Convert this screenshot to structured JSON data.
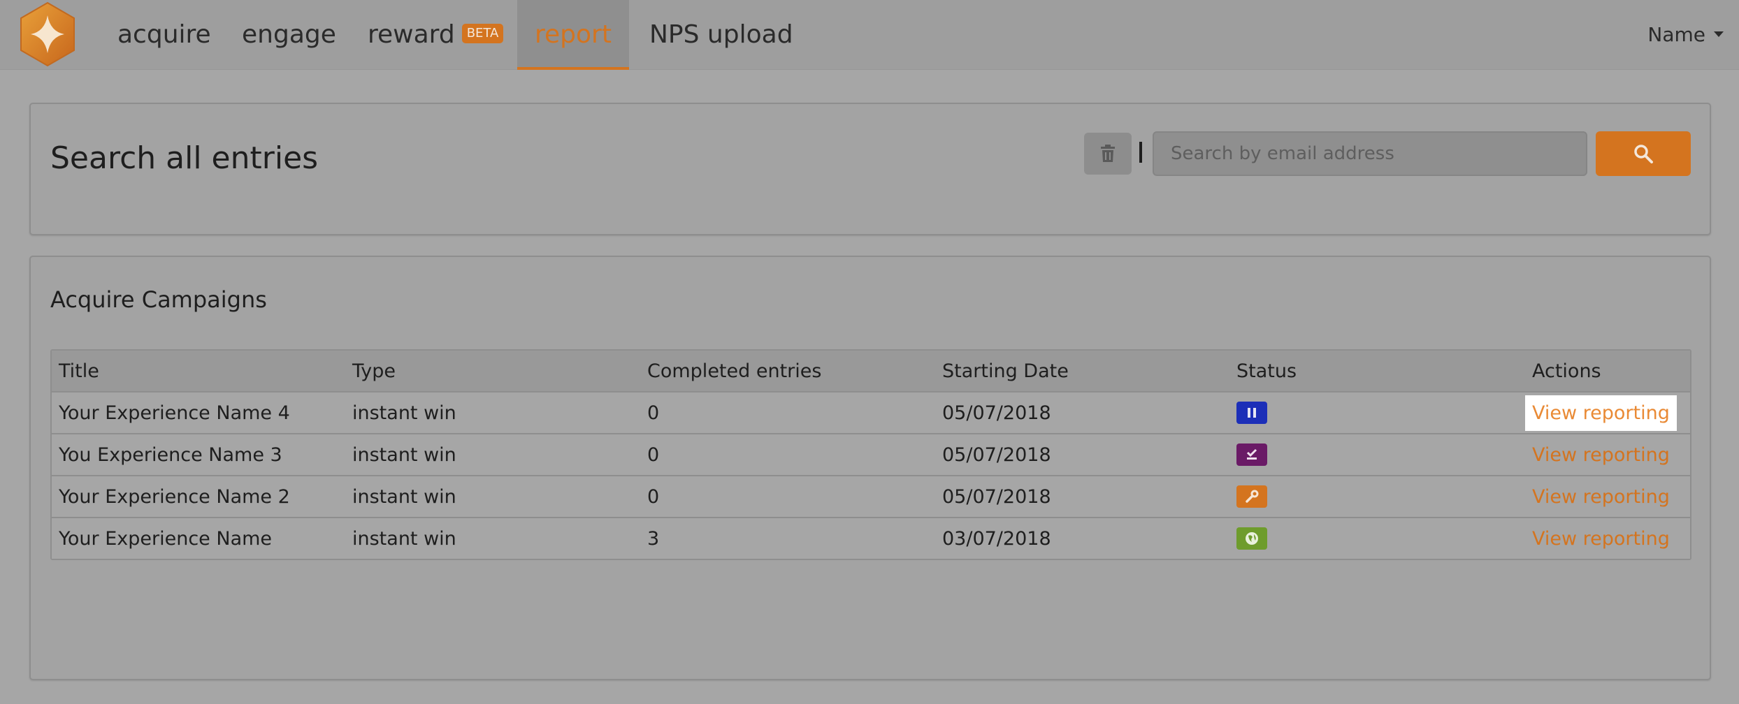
{
  "colors": {
    "accent": "#d4741f",
    "status_paused": "#1c2fb8",
    "status_scheduled": "#6a1a66",
    "status_draft": "#d4741f",
    "status_live": "#6e9c2c"
  },
  "nav": {
    "items": [
      {
        "label": "acquire"
      },
      {
        "label": "engage"
      },
      {
        "label": "reward",
        "badge": "BETA"
      },
      {
        "label": "report",
        "active": true
      },
      {
        "label": "NPS upload"
      }
    ],
    "user": "Name"
  },
  "search": {
    "title": "Search all entries",
    "placeholder": "Search by email address",
    "clear_icon": "trash-icon",
    "search_icon": "search-icon"
  },
  "campaigns": {
    "title": "Acquire Campaigns",
    "columns": [
      "Title",
      "Type",
      "Completed entries",
      "Starting Date",
      "Status",
      "Actions"
    ],
    "rows": [
      {
        "title": "Your Experience Name 4",
        "type": "instant win",
        "completed": "0",
        "date": "05/07/2018",
        "status_icon": "pause-icon",
        "action": "View reporting"
      },
      {
        "title": "You Experience Name 3",
        "type": "instant win",
        "completed": "0",
        "date": "05/07/2018",
        "status_icon": "scheduled-icon",
        "action": "View reporting"
      },
      {
        "title": "Your Experience Name 2",
        "type": "instant win",
        "completed": "0",
        "date": "05/07/2018",
        "status_icon": "wrench-icon",
        "action": "View reporting"
      },
      {
        "title": "Your Experience Name",
        "type": "instant win",
        "completed": "3",
        "date": "03/07/2018",
        "status_icon": "globe-icon",
        "action": "View reporting"
      }
    ]
  }
}
